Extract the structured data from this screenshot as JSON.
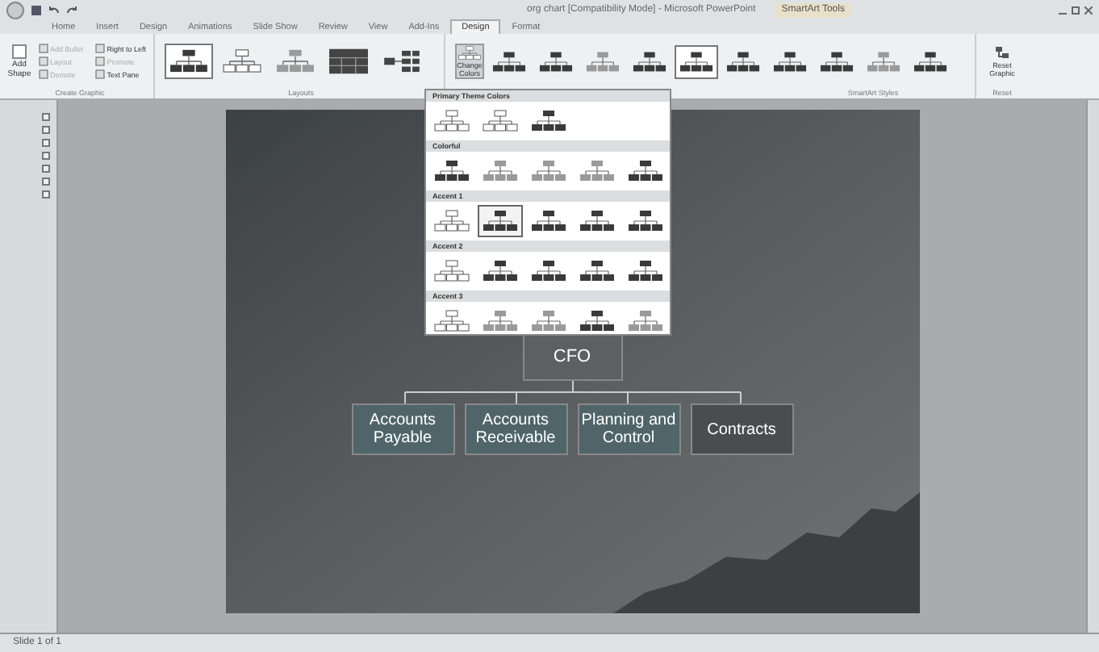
{
  "window": {
    "title": "org chart [Compatibility Mode] - Microsoft PowerPoint",
    "context_group": "SmartArt Tools"
  },
  "tabs": [
    {
      "label": "Home",
      "selected": false
    },
    {
      "label": "Insert",
      "selected": false
    },
    {
      "label": "Design",
      "selected": false
    },
    {
      "label": "Animations",
      "selected": false
    },
    {
      "label": "Slide Show",
      "selected": false
    },
    {
      "label": "Review",
      "selected": false
    },
    {
      "label": "View",
      "selected": false
    },
    {
      "label": "Add-Ins",
      "selected": false
    },
    {
      "label": "Design",
      "selected": true
    },
    {
      "label": "Format",
      "selected": false
    }
  ],
  "create_graphic": {
    "label": "Create Graphic",
    "add_shape": "Add Shape",
    "small_buttons": [
      {
        "label": "Add Bullet",
        "disabled": true
      },
      {
        "label": "Right to Left",
        "disabled": false
      },
      {
        "label": "Layout",
        "disabled": true
      },
      {
        "label": "Promote",
        "disabled": true
      },
      {
        "label": "Demote",
        "disabled": true
      },
      {
        "label": "Text Pane",
        "disabled": false
      }
    ]
  },
  "layouts": {
    "label": "Layouts",
    "items": [
      {
        "kind": "dark",
        "selected": true
      },
      {
        "kind": "outline",
        "selected": false
      },
      {
        "kind": "light",
        "selected": false
      },
      {
        "kind": "grid",
        "selected": false
      },
      {
        "kind": "side",
        "selected": false
      }
    ]
  },
  "smartart_styles": {
    "label": "SmartArt Styles",
    "change_colors": "Change Colors",
    "items": [
      {
        "kind": "dark",
        "selected": false
      },
      {
        "kind": "dark",
        "selected": false
      },
      {
        "kind": "light",
        "selected": false
      },
      {
        "kind": "dark",
        "selected": false
      },
      {
        "kind": "dark",
        "selected": true
      },
      {
        "kind": "dark",
        "selected": false
      },
      {
        "kind": "dark",
        "selected": false
      },
      {
        "kind": "dark",
        "selected": false
      },
      {
        "kind": "light",
        "selected": false
      },
      {
        "kind": "dark",
        "selected": false
      }
    ]
  },
  "reset": {
    "label": "Reset",
    "button": "Reset Graphic"
  },
  "color_gallery": {
    "sections": [
      {
        "title": "Primary Theme Colors",
        "items": [
          {
            "kind": "outline",
            "selected": false
          },
          {
            "kind": "outline",
            "selected": false
          },
          {
            "kind": "dark",
            "selected": false
          }
        ]
      },
      {
        "title": "Colorful",
        "items": [
          {
            "kind": "dark",
            "selected": false
          },
          {
            "kind": "light",
            "selected": false
          },
          {
            "kind": "light",
            "selected": false
          },
          {
            "kind": "light",
            "selected": false
          },
          {
            "kind": "dark",
            "selected": false
          }
        ]
      },
      {
        "title": "Accent 1",
        "items": [
          {
            "kind": "outline",
            "selected": false
          },
          {
            "kind": "dark",
            "selected": true
          },
          {
            "kind": "dark",
            "selected": false
          },
          {
            "kind": "dark",
            "selected": false
          },
          {
            "kind": "dark",
            "selected": false
          }
        ]
      },
      {
        "title": "Accent 2",
        "items": [
          {
            "kind": "outline",
            "selected": false
          },
          {
            "kind": "dark",
            "selected": false
          },
          {
            "kind": "dark",
            "selected": false
          },
          {
            "kind": "dark",
            "selected": false
          },
          {
            "kind": "dark",
            "selected": false
          }
        ]
      },
      {
        "title": "Accent 3",
        "items": [
          {
            "kind": "outline",
            "selected": false
          },
          {
            "kind": "light",
            "selected": false
          },
          {
            "kind": "light",
            "selected": false
          },
          {
            "kind": "dark",
            "selected": false
          },
          {
            "kind": "light",
            "selected": false
          }
        ]
      }
    ]
  },
  "slide": {
    "top": "CFO",
    "reports": [
      {
        "label": "Accounts Payable",
        "kind": "accent"
      },
      {
        "label": "Accounts Receivable",
        "kind": "accent"
      },
      {
        "label": "Planning and Control",
        "kind": "accent"
      },
      {
        "label": "Contracts",
        "kind": "dark"
      }
    ]
  },
  "status_bar": {
    "slide_info": "Slide 1 of 1"
  }
}
